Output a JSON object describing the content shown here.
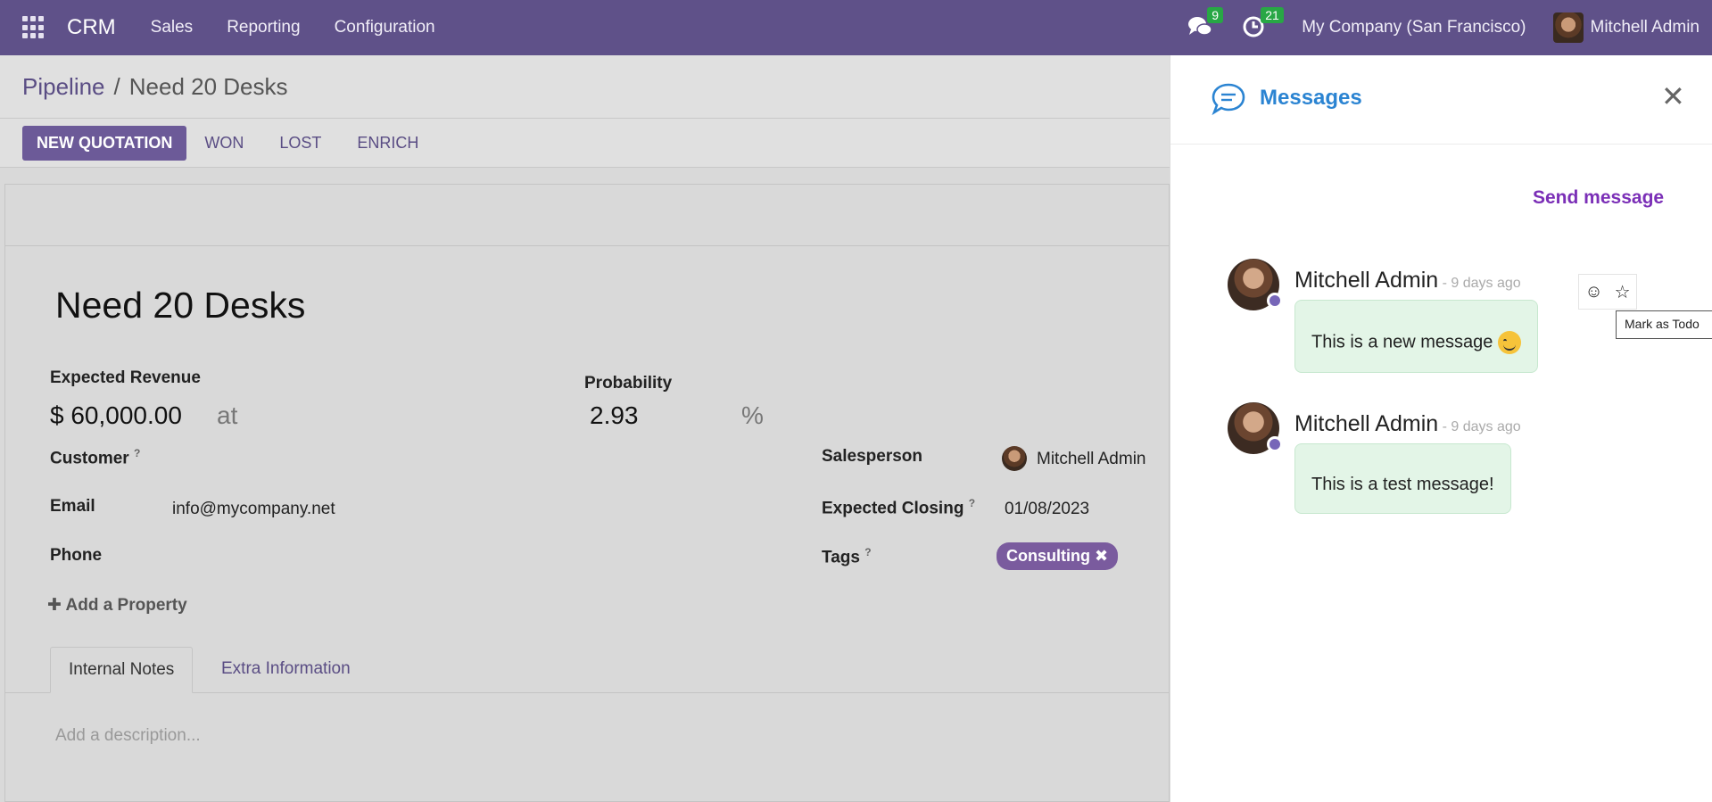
{
  "navbar": {
    "brand": "CRM",
    "menu": [
      "Sales",
      "Reporting",
      "Configuration"
    ],
    "messages_count": "9",
    "activities_count": "21",
    "company": "My Company (San Francisco)",
    "user": "Mitchell Admin"
  },
  "breadcrumb": {
    "parent": "Pipeline",
    "separator": "/",
    "current": "Need 20 Desks"
  },
  "buttons": {
    "new_quotation": "NEW QUOTATION",
    "won": "WON",
    "lost": "LOST",
    "enrich": "ENRICH"
  },
  "form": {
    "title": "Need 20 Desks",
    "expected_revenue_label": "Expected Revenue",
    "expected_revenue": "$ 60,000.00",
    "at": "at",
    "probability_label": "Probability",
    "probability": "2.93",
    "percent": "%",
    "customer_label": "Customer",
    "email_label": "Email",
    "email": "info@mycompany.net",
    "phone_label": "Phone",
    "salesperson_label": "Salesperson",
    "salesperson": "Mitchell Admin",
    "closing_label": "Expected Closing",
    "closing": "01/08/2023",
    "tags_label": "Tags",
    "tag": "Consulting",
    "add_property": "Add a Property",
    "help_mark": "?"
  },
  "tabs": {
    "internal_notes": "Internal Notes",
    "extra_info": "Extra Information"
  },
  "description_placeholder": "Add a description...",
  "messages_panel": {
    "title": "Messages",
    "send": "Send message",
    "messages": [
      {
        "author": "Mitchell Admin",
        "date": " - 9 days ago",
        "body": "This is a new message"
      },
      {
        "author": "Mitchell Admin",
        "date": " - 9 days ago",
        "body": "This is a test message!"
      }
    ],
    "tooltip": "Mark as Todo"
  },
  "colors": {
    "navbar": "#5f5189",
    "primary": "#6c5a98",
    "link": "#5a4d84",
    "messages_title": "#2b84d2",
    "send_message": "#7b2fb7",
    "bubble": "#e3f5e7",
    "badge": "#28a745",
    "tag": "#7a5b9e"
  }
}
